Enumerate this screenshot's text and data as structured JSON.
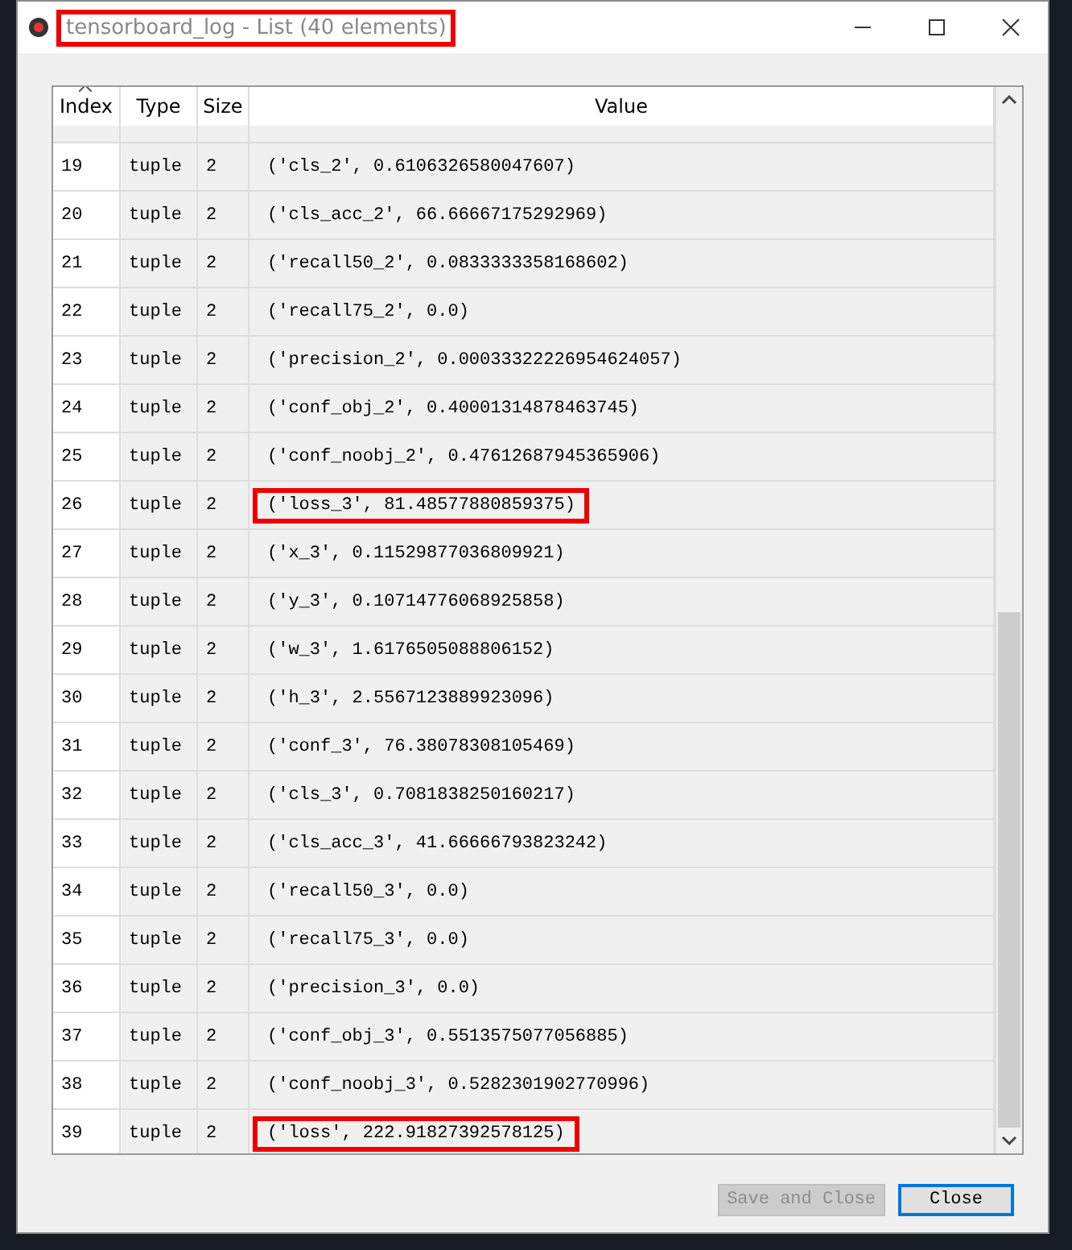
{
  "window": {
    "title": "tensorboard_log - List (40 elements)",
    "title_highlighted": true
  },
  "table": {
    "columns": [
      "Index",
      "Type",
      "Size",
      "Value"
    ],
    "rows": [
      {
        "index": "19",
        "type": "tuple",
        "size": "2",
        "value": "('cls_2', 0.6106326580047607)",
        "highlighted": false
      },
      {
        "index": "20",
        "type": "tuple",
        "size": "2",
        "value": "('cls_acc_2', 66.66667175292969)",
        "highlighted": false
      },
      {
        "index": "21",
        "type": "tuple",
        "size": "2",
        "value": "('recall50_2', 0.0833333358168602)",
        "highlighted": false
      },
      {
        "index": "22",
        "type": "tuple",
        "size": "2",
        "value": "('recall75_2', 0.0)",
        "highlighted": false
      },
      {
        "index": "23",
        "type": "tuple",
        "size": "2",
        "value": "('precision_2', 0.00033322226954624057)",
        "highlighted": false
      },
      {
        "index": "24",
        "type": "tuple",
        "size": "2",
        "value": "('conf_obj_2', 0.40001314878463745)",
        "highlighted": false
      },
      {
        "index": "25",
        "type": "tuple",
        "size": "2",
        "value": "('conf_noobj_2', 0.47612687945365906)",
        "highlighted": false
      },
      {
        "index": "26",
        "type": "tuple",
        "size": "2",
        "value": "('loss_3', 81.48577880859375)",
        "highlighted": true
      },
      {
        "index": "27",
        "type": "tuple",
        "size": "2",
        "value": "('x_3', 0.11529877036809921)",
        "highlighted": false
      },
      {
        "index": "28",
        "type": "tuple",
        "size": "2",
        "value": "('y_3', 0.10714776068925858)",
        "highlighted": false
      },
      {
        "index": "29",
        "type": "tuple",
        "size": "2",
        "value": "('w_3', 1.6176505088806152)",
        "highlighted": false
      },
      {
        "index": "30",
        "type": "tuple",
        "size": "2",
        "value": "('h_3', 2.5567123889923096)",
        "highlighted": false
      },
      {
        "index": "31",
        "type": "tuple",
        "size": "2",
        "value": "('conf_3', 76.38078308105469)",
        "highlighted": false
      },
      {
        "index": "32",
        "type": "tuple",
        "size": "2",
        "value": "('cls_3', 0.7081838250160217)",
        "highlighted": false
      },
      {
        "index": "33",
        "type": "tuple",
        "size": "2",
        "value": "('cls_acc_3', 41.66666793823242)",
        "highlighted": false
      },
      {
        "index": "34",
        "type": "tuple",
        "size": "2",
        "value": "('recall50_3', 0.0)",
        "highlighted": false
      },
      {
        "index": "35",
        "type": "tuple",
        "size": "2",
        "value": "('recall75_3', 0.0)",
        "highlighted": false
      },
      {
        "index": "36",
        "type": "tuple",
        "size": "2",
        "value": "('precision_3', 0.0)",
        "highlighted": false
      },
      {
        "index": "37",
        "type": "tuple",
        "size": "2",
        "value": "('conf_obj_3', 0.5513575077056885)",
        "highlighted": false
      },
      {
        "index": "38",
        "type": "tuple",
        "size": "2",
        "value": "('conf_noobj_3', 0.5282301902770996)",
        "highlighted": false
      },
      {
        "index": "39",
        "type": "tuple",
        "size": "2",
        "value": "('loss', 222.91827392578125)",
        "highlighted": true
      }
    ]
  },
  "buttons": [
    {
      "label": "Save and Close",
      "disabled": true,
      "selected": false
    },
    {
      "label": "Close",
      "disabled": false,
      "selected": true
    }
  ]
}
